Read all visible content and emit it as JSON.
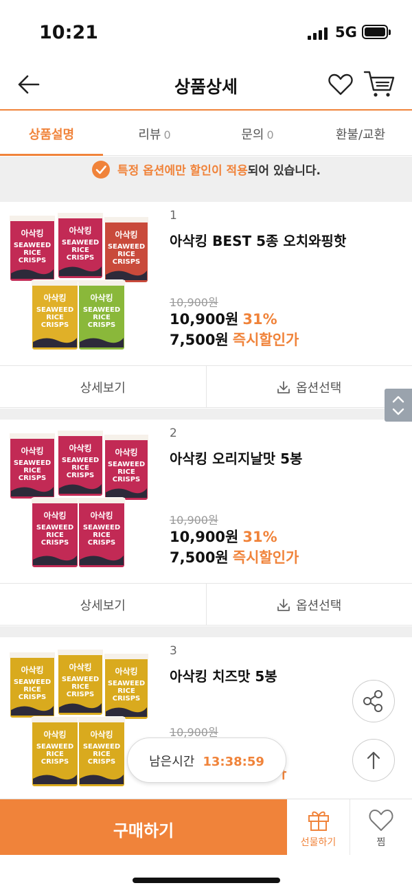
{
  "status": {
    "time": "10:21",
    "network": "5G"
  },
  "header": {
    "title": "상품상세"
  },
  "tabs": [
    {
      "label": "상품설명",
      "count": ""
    },
    {
      "label": "리뷰",
      "count": "0"
    },
    {
      "label": "문의",
      "count": "0"
    },
    {
      "label": "환불/교환",
      "count": ""
    }
  ],
  "notice": {
    "highlight": "특정 옵션에만 할인이 적용",
    "rest": "되어 있습니다."
  },
  "products": [
    {
      "index": "1",
      "name": "아삭킹 BEST 5종 오치와핑핫",
      "original_price": "10,900원",
      "sale_price": "10,900원",
      "discount": "31%",
      "final_price": "7,500원",
      "final_tag": "즉시할인가",
      "flavor_colors": [
        "#c22a55",
        "#c22a55",
        "#c94a3b",
        "#e0b028",
        "#8ab83a"
      ]
    },
    {
      "index": "2",
      "name": "아삭킹 오리지날맛 5봉",
      "original_price": "10,900원",
      "sale_price": "10,900원",
      "discount": "31%",
      "final_price": "7,500원",
      "final_tag": "즉시할인가",
      "flavor_colors": [
        "#c22a55",
        "#c22a55",
        "#c22a55",
        "#c22a55",
        "#c22a55"
      ]
    },
    {
      "index": "3",
      "name": "아삭킹 치즈맛 5봉",
      "original_price": "10,900원",
      "sale_price": "",
      "discount": "",
      "final_price": "",
      "final_tag": "가",
      "flavor_colors": [
        "#d9aa1e",
        "#d9aa1e",
        "#d9aa1e",
        "#d9aa1e",
        "#d9aa1e"
      ]
    }
  ],
  "bag_labels": {
    "brand": "아삭킹",
    "line1": "SEAWEED",
    "line2": "RICE",
    "line3": "CRISPS"
  },
  "actions": {
    "detail": "상세보기",
    "option": "옵션선택"
  },
  "timer": {
    "label": "남은시간",
    "value": "13:38:59"
  },
  "bottom": {
    "buy": "구매하기",
    "gift": "선물하기",
    "zzim": "찜"
  },
  "colors": {
    "accent": "#f0833a"
  }
}
